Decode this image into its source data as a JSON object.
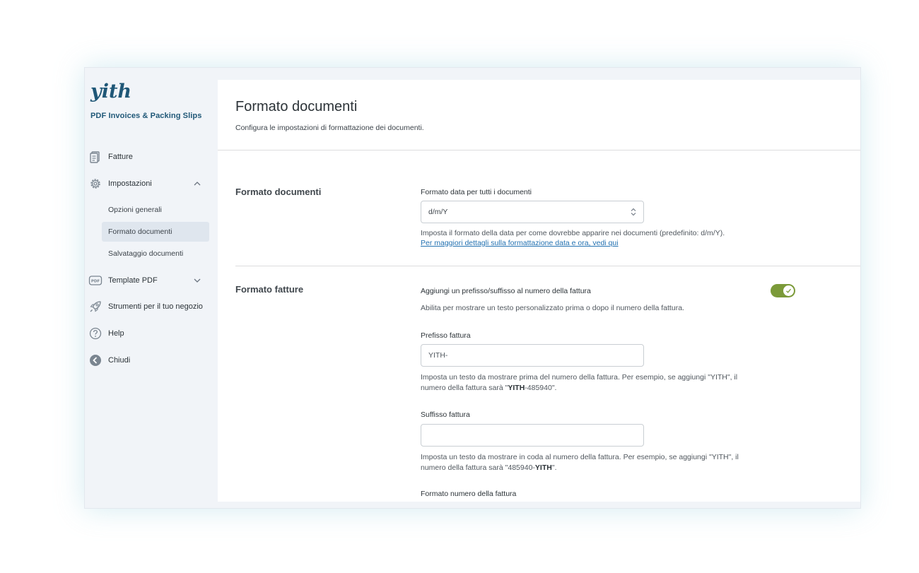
{
  "sidebar": {
    "brand": "yith",
    "plugin_name": "PDF Invoices & Packing Slips",
    "items": [
      {
        "label": "Fatture",
        "icon": "invoice-icon"
      },
      {
        "label": "Impostazioni",
        "icon": "gear-icon",
        "expanded": true
      },
      {
        "label": "Template PDF",
        "icon": "pdf-icon",
        "expanded": false
      },
      {
        "label": "Strumenti per il tuo negozio",
        "icon": "rocket-icon"
      },
      {
        "label": "Help",
        "icon": "help-icon"
      },
      {
        "label": "Chiudi",
        "icon": "back-arrow-icon"
      }
    ],
    "subitems": [
      {
        "label": "Opzioni generali",
        "active": false
      },
      {
        "label": "Formato documenti",
        "active": true
      },
      {
        "label": "Salvataggio documenti",
        "active": false
      }
    ]
  },
  "main": {
    "title": "Formato documenti",
    "description": "Configura le impostazioni di formattazione dei documenti.",
    "section_documents": {
      "title": "Formato documenti",
      "date_label": "Formato data per tutti i documenti",
      "date_value": "d/m/Y",
      "date_desc": "Imposta il formato della data per come dovrebbe apparire nei documenti (predefinito: d/m/Y).",
      "date_link": "Per maggiori dettagli sulla formattazione data e ora, vedi qui"
    },
    "section_invoices": {
      "title": "Formato fatture",
      "prefix_toggle_label": "Aggiungi un prefisso/suffisso al numero della fattura",
      "prefix_toggle_desc": "Abilita per mostrare un testo personalizzato prima o dopo il numero della fattura.",
      "prefix_toggle_on": true,
      "prefix_label": "Prefisso fattura",
      "prefix_value": "YITH-",
      "prefix_desc_1": "Imposta un testo da mostrare prima del numero della fattura. Per esempio, se aggiungi \"YITH\", il numero della fattura sarà \"",
      "prefix_desc_bold": "YITH",
      "prefix_desc_2": "-485940\".",
      "suffix_label": "Suffisso fattura",
      "suffix_value": "",
      "suffix_desc_1": "Imposta un testo da mostrare in coda al numero della fattura. Per esempio, se aggiungi \"YITH\", il numero della fattura sarà \"485940-",
      "suffix_desc_bold": "YITH",
      "suffix_desc_2": "\".",
      "number_format_label": "Formato numero della fattura"
    }
  },
  "colors": {
    "accent_toggle": "#7b9a39",
    "brand": "#1f5777",
    "link": "#2271b1"
  }
}
